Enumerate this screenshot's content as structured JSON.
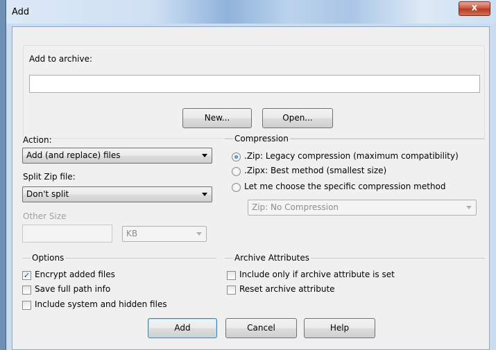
{
  "window": {
    "title": "Add",
    "close_glyph": "x"
  },
  "archive": {
    "label": "Add to archive:",
    "value": "",
    "new_button": "New...",
    "open_button": "Open..."
  },
  "action": {
    "label": "Action:",
    "selected": "Add (and replace) files"
  },
  "split": {
    "label": "Split Zip file:",
    "selected": "Don't split"
  },
  "other_size": {
    "label": "Other Size",
    "value": "",
    "unit": "KB"
  },
  "compression": {
    "title": "Compression",
    "options": [
      {
        "label": ".Zip: Legacy compression (maximum compatibility)",
        "checked": true
      },
      {
        "label": ".Zipx: Best method (smallest size)",
        "checked": false
      },
      {
        "label": "Let me choose the specific compression method",
        "checked": false
      }
    ],
    "method_selected": "Zip: No Compression"
  },
  "options": {
    "title": "Options",
    "items": [
      {
        "label": "Encrypt added files",
        "checked": true
      },
      {
        "label": "Save full path info",
        "checked": false
      },
      {
        "label": "Include system and hidden files",
        "checked": false
      }
    ]
  },
  "attributes": {
    "title": "Archive Attributes",
    "items": [
      {
        "label": "Include only if archive attribute is set",
        "checked": false
      },
      {
        "label": "Reset archive attribute",
        "checked": false
      }
    ]
  },
  "buttons": {
    "add": "Add",
    "cancel": "Cancel",
    "help": "Help"
  },
  "icons": {
    "check": "check-mark-icon",
    "close": "close-icon",
    "dropdown": "chevron-down-icon"
  }
}
